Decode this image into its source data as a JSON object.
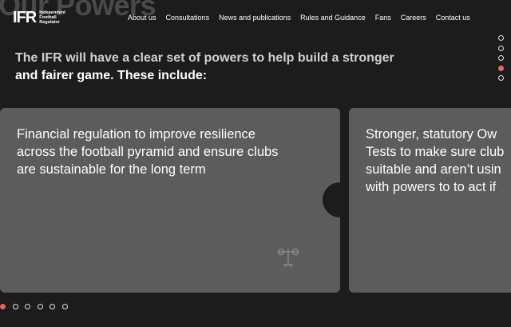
{
  "background_heading": "Our Powers",
  "logo": {
    "mark": "IFR",
    "lines": [
      "Independent",
      "Football",
      "Regulator"
    ]
  },
  "nav": [
    "About us",
    "Consultations",
    "News and publications",
    "Rules and Guidance",
    "Fans",
    "Careers",
    "Contact us"
  ],
  "intro": {
    "line1": "The IFR will have a clear set of powers to help build a stronger",
    "line2": "and fairer game. These include:"
  },
  "cards": [
    {
      "text": "Financial regulation to improve resilience across the football pyramid and ensure clubs are sustainable for the long term",
      "icon": "balance-scale-icon"
    },
    {
      "lines": [
        "Stronger, statutory Ow",
        "Tests to make sure club",
        "suitable and aren’t usin",
        "with powers to to act if"
      ]
    }
  ],
  "side_pagination": {
    "count": 5,
    "active_index": 3
  },
  "bottom_pagination": {
    "count": 6,
    "active_index": 0
  },
  "colors": {
    "accent": "#e2675d",
    "card": "#5c5c5d",
    "background": "#1c1c1d"
  }
}
